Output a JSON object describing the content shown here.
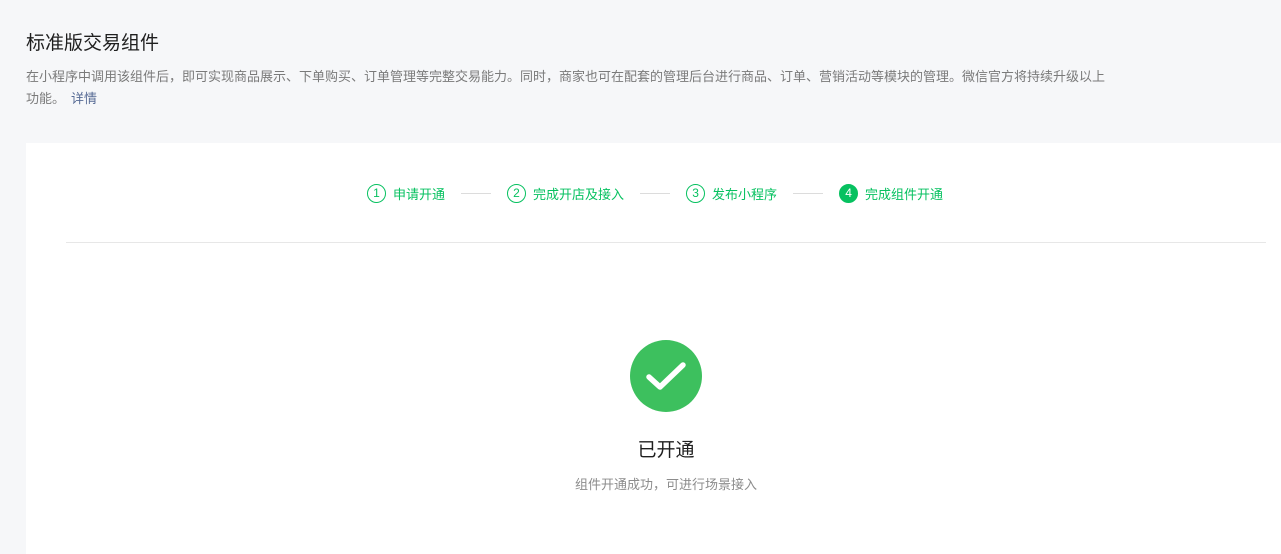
{
  "header": {
    "title": "标准版交易组件",
    "description": "在小程序中调用该组件后，即可实现商品展示、下单购买、订单管理等完整交易能力。同时，商家也可在配套的管理后台进行商品、订单、营销活动等模块的管理。微信官方将持续升级以上功能。",
    "detail_link": "详情"
  },
  "steps": [
    {
      "number": "1",
      "label": "申请开通",
      "status": "done"
    },
    {
      "number": "2",
      "label": "完成开店及接入",
      "status": "done"
    },
    {
      "number": "3",
      "label": "发布小程序",
      "status": "done"
    },
    {
      "number": "4",
      "label": "完成组件开通",
      "status": "active"
    }
  ],
  "result": {
    "icon": "check-circle-icon",
    "title": "已开通",
    "description": "组件开通成功，可进行场景接入"
  },
  "colors": {
    "brand_green": "#07c160",
    "success_icon": "#3dc05e",
    "link": "#576b95"
  }
}
